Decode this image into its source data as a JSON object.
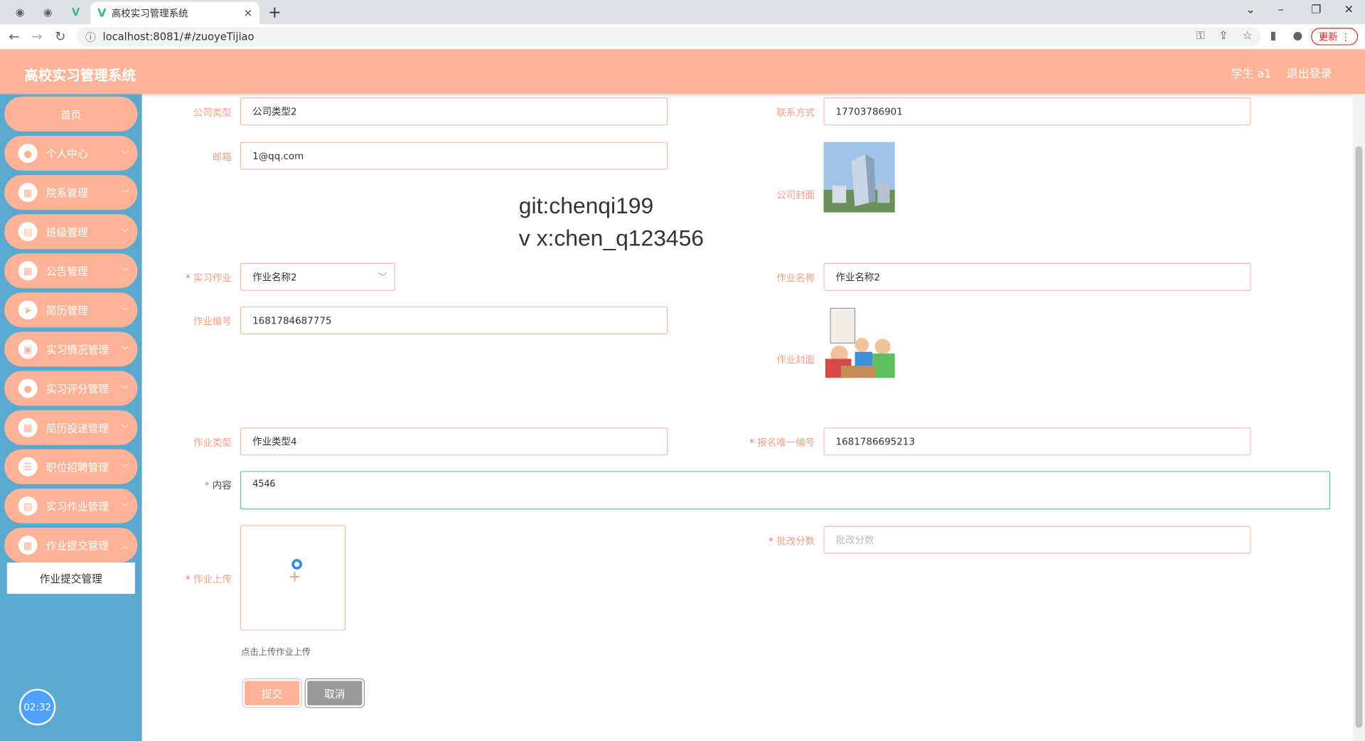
{
  "browser": {
    "tab_title": "高校实习管理系统",
    "url": "localhost:8081/#/zuoyeTijiao",
    "update_label": "更新"
  },
  "header": {
    "app_title": "高校实习管理系统",
    "user_label": "学生 a1",
    "logout_label": "退出登录"
  },
  "sidebar": {
    "items": [
      {
        "label": "首页",
        "icon": "home-icon"
      },
      {
        "label": "个人中心",
        "icon": "user-icon"
      },
      {
        "label": "院系管理",
        "icon": "grid-icon"
      },
      {
        "label": "班级管理",
        "icon": "briefcase-icon"
      },
      {
        "label": "公告管理",
        "icon": "grid-icon"
      },
      {
        "label": "简历管理",
        "icon": "send-icon"
      },
      {
        "label": "实习情况管理",
        "icon": "document-icon"
      },
      {
        "label": "实习评分管理",
        "icon": "location-icon"
      },
      {
        "label": "简历投递管理",
        "icon": "grid-icon"
      },
      {
        "label": "职位招聘管理",
        "icon": "list-icon"
      },
      {
        "label": "实习作业管理",
        "icon": "image-icon"
      },
      {
        "label": "作业提交管理",
        "icon": "apps-icon"
      }
    ],
    "active_submenu": "作业提交管理",
    "timer": "02:32"
  },
  "watermark": {
    "line1": "git:chenqi199",
    "line2": "v x:chen_q123456"
  },
  "form": {
    "company_type": {
      "label": "公司类型",
      "value": "公司类型2"
    },
    "contact": {
      "label": "联系方式",
      "value": "17703786901"
    },
    "email": {
      "label": "邮箱",
      "value": "1@qq.com"
    },
    "company_cover": {
      "label": "公司封面"
    },
    "internship_homework": {
      "label": "实习作业",
      "value": "作业名称2"
    },
    "homework_name": {
      "label": "作业名称",
      "value": "作业名称2"
    },
    "homework_no": {
      "label": "作业编号",
      "value": "1681784687775"
    },
    "homework_cover": {
      "label": "作业封面"
    },
    "homework_type": {
      "label": "作业类型",
      "value": "作业类型4"
    },
    "signup_id": {
      "label": "报名唯一编号",
      "value": "1681786695213"
    },
    "content": {
      "label": "内容",
      "value": "4546"
    },
    "score": {
      "label": "批改分数",
      "placeholder": "批改分数"
    },
    "upload": {
      "label": "作业上传",
      "hint": "点击上传作业上传"
    },
    "submit_label": "提交",
    "cancel_label": "取消"
  },
  "colors": {
    "accent": "#ffb396",
    "sidebar_bg": "#5aa9d1",
    "label": "#f4a085"
  }
}
